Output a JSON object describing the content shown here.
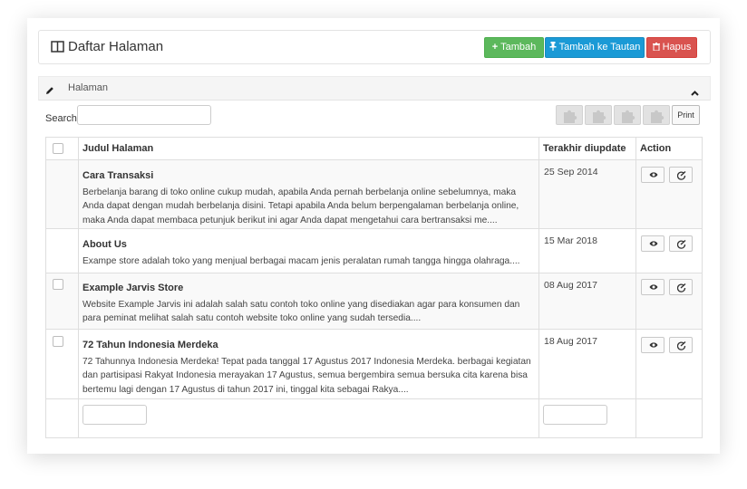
{
  "header": {
    "title": "Daftar Halaman",
    "buttons": {
      "tambah": "Tambah",
      "tautan": "Tambah ke Tautan",
      "hapus": "Hapus"
    }
  },
  "section": {
    "label": "Halaman"
  },
  "search": {
    "label": "Search:",
    "value": ""
  },
  "toolbar": {
    "print": "Print"
  },
  "table": {
    "columns": [
      "Judul Halaman",
      "Terakhir diupdate",
      "Action"
    ],
    "rows": [
      {
        "title": "Cara Transaksi",
        "desc": "Berbelanja barang di toko online cukup mudah, apabila Anda pernah berbelanja online sebelumnya, maka Anda dapat dengan mudah berbelanja disini. Tetapi apabila Anda belum berpengalaman berbelanja online, maka Anda dapat membaca petunjuk berikut ini agar Anda dapat mengetahui cara bertransaksi me....",
        "date": "25 Sep 2014"
      },
      {
        "title": "About Us",
        "desc": "Exampe store adalah toko yang menjual berbagai macam jenis peralatan rumah tangga hingga olahraga....",
        "date": "15 Mar 2018"
      },
      {
        "title": "Example Jarvis Store",
        "desc": "Website Example Jarvis ini adalah salah satu contoh toko online yang disediakan agar para konsumen dan para peminat melihat salah satu contoh website toko online yang sudah tersedia....",
        "date": "08 Aug 2017"
      },
      {
        "title": "72 Tahun Indonesia Merdeka",
        "desc": "72 Tahunnya Indonesia Merdeka! Tepat pada tanggal 17 Agustus 2017 Indonesia Merdeka. berbagai kegiatan dan partisipasi Rakyat Indonesia merayakan 17 Agustus, semua bergembira semua bersuka cita karena bisa bertemu lagi dengan 17 Agustus di tahun 2017 ini, tinggal kita sebagai Rakya....",
        "date": "18 Aug 2017"
      }
    ],
    "filters": {
      "title_value": "",
      "date_value": ""
    }
  },
  "icons": [
    "layout-icon",
    "plus-icon",
    "pin-icon",
    "trash-icon",
    "pencil-icon",
    "chevron-up-icon",
    "puzzle-icon",
    "eye-icon",
    "edit-icon"
  ],
  "colors": {
    "success": "#5cb85c",
    "info": "#1a9ad6",
    "danger": "#d9534f"
  }
}
